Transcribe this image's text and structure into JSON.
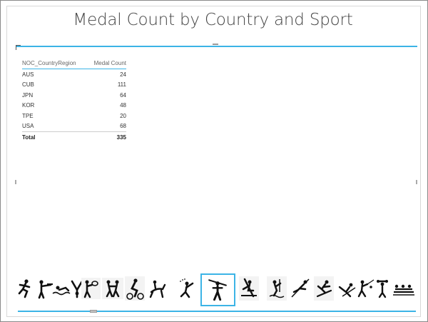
{
  "report": {
    "title": "Medal Count by Country and Sport"
  },
  "table": {
    "columns": [
      "NOC_CountryRegion",
      "Medal Count"
    ],
    "rows": [
      {
        "country": "AUS",
        "count": "24"
      },
      {
        "country": "CUB",
        "count": "111"
      },
      {
        "country": "JPN",
        "count": "64"
      },
      {
        "country": "KOR",
        "count": "48"
      },
      {
        "country": "TPE",
        "count": "20"
      },
      {
        "country": "USA",
        "count": "68"
      }
    ],
    "total_label": "Total",
    "total_value": "335"
  },
  "sport_slicer": {
    "icons": [
      "athlete-running-icon",
      "shooting-icon",
      "swimming-icon",
      "gymnastics-icon",
      "tennis-icon",
      "wrestling-icon",
      "cycling-icon",
      "equestrian-icon",
      "rhythmic-gymnastics-icon",
      "canoe-slalom-icon",
      "rowing-icon",
      "sailing-icon",
      "ski-jump-icon",
      "snowboard-icon",
      "figure-skating-icon",
      "fencing-icon",
      "weightlifting-icon",
      "bobsleigh-icon"
    ],
    "selected_index": 9,
    "selection_color": "#3cb4e6"
  }
}
